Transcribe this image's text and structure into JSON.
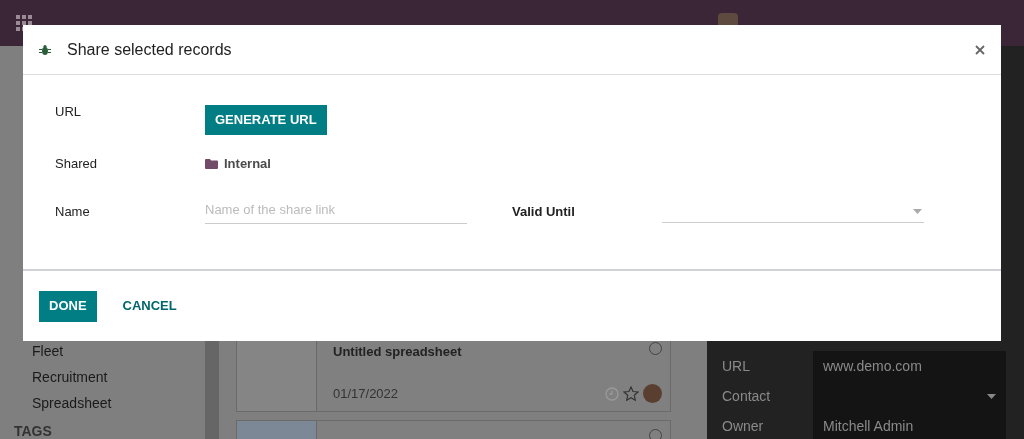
{
  "sidebar": {
    "items": [
      "Fleet",
      "Recruitment",
      "Spreadsheet"
    ],
    "section": "TAGS"
  },
  "documents": [
    {
      "title": "Untitled spreadsheet",
      "date": "01/17/2022",
      "selected": false
    },
    {
      "selected": false
    }
  ],
  "details": {
    "fields": [
      {
        "label": "URL",
        "value": "www.demo.com",
        "kind": "text"
      },
      {
        "label": "Contact",
        "kind": "select"
      },
      {
        "label": "Owner",
        "value": "Mitchell Admin",
        "kind": "text"
      }
    ]
  },
  "dialog": {
    "title": "Share selected records",
    "fields": [
      {
        "label": "URL",
        "kind": "button",
        "value": "GENERATE URL"
      },
      {
        "label": "Shared",
        "kind": "tag",
        "value": "Internal"
      },
      {
        "label": "Name",
        "kind": "input",
        "placeholder": "Name of the share link"
      }
    ],
    "valid_until": {
      "label": "Valid Until",
      "kind": "select"
    },
    "buttons": [
      {
        "label": "DONE",
        "primary": true
      },
      {
        "label": "CANCEL",
        "primary": false
      }
    ]
  }
}
